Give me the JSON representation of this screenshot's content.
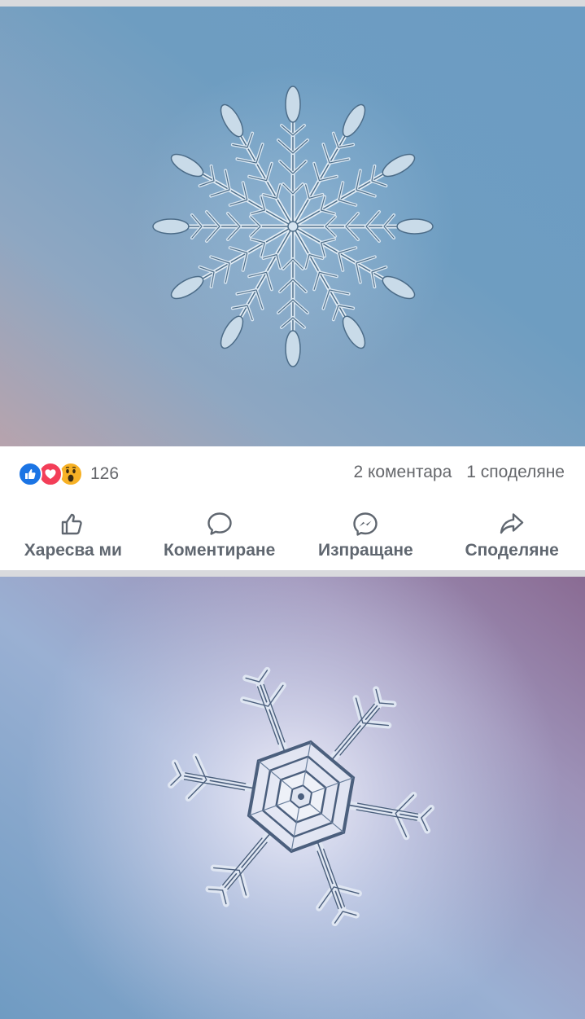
{
  "post": {
    "reactions": {
      "icons": [
        "like-icon",
        "love-icon",
        "wow-icon"
      ],
      "count": "126"
    },
    "comments_text": "2 коментара",
    "shares_text": "1 споделяне"
  },
  "actions": {
    "like": {
      "label": "Харесва ми",
      "icon": "thumbs-up-icon"
    },
    "comment": {
      "label": "Коментиране",
      "icon": "comment-bubble-icon"
    },
    "send": {
      "label": "Изпращане",
      "icon": "messenger-icon"
    },
    "share": {
      "label": "Споделяне",
      "icon": "share-arrow-icon"
    }
  },
  "colors": {
    "like_blue": "#1b74e4",
    "love_red": "#f33e58",
    "wow_yellow": "#f7b125",
    "text_grey": "#65676b",
    "photo1_sky": "#6e9dc1",
    "photo2_sky": "#8aa3c9"
  }
}
